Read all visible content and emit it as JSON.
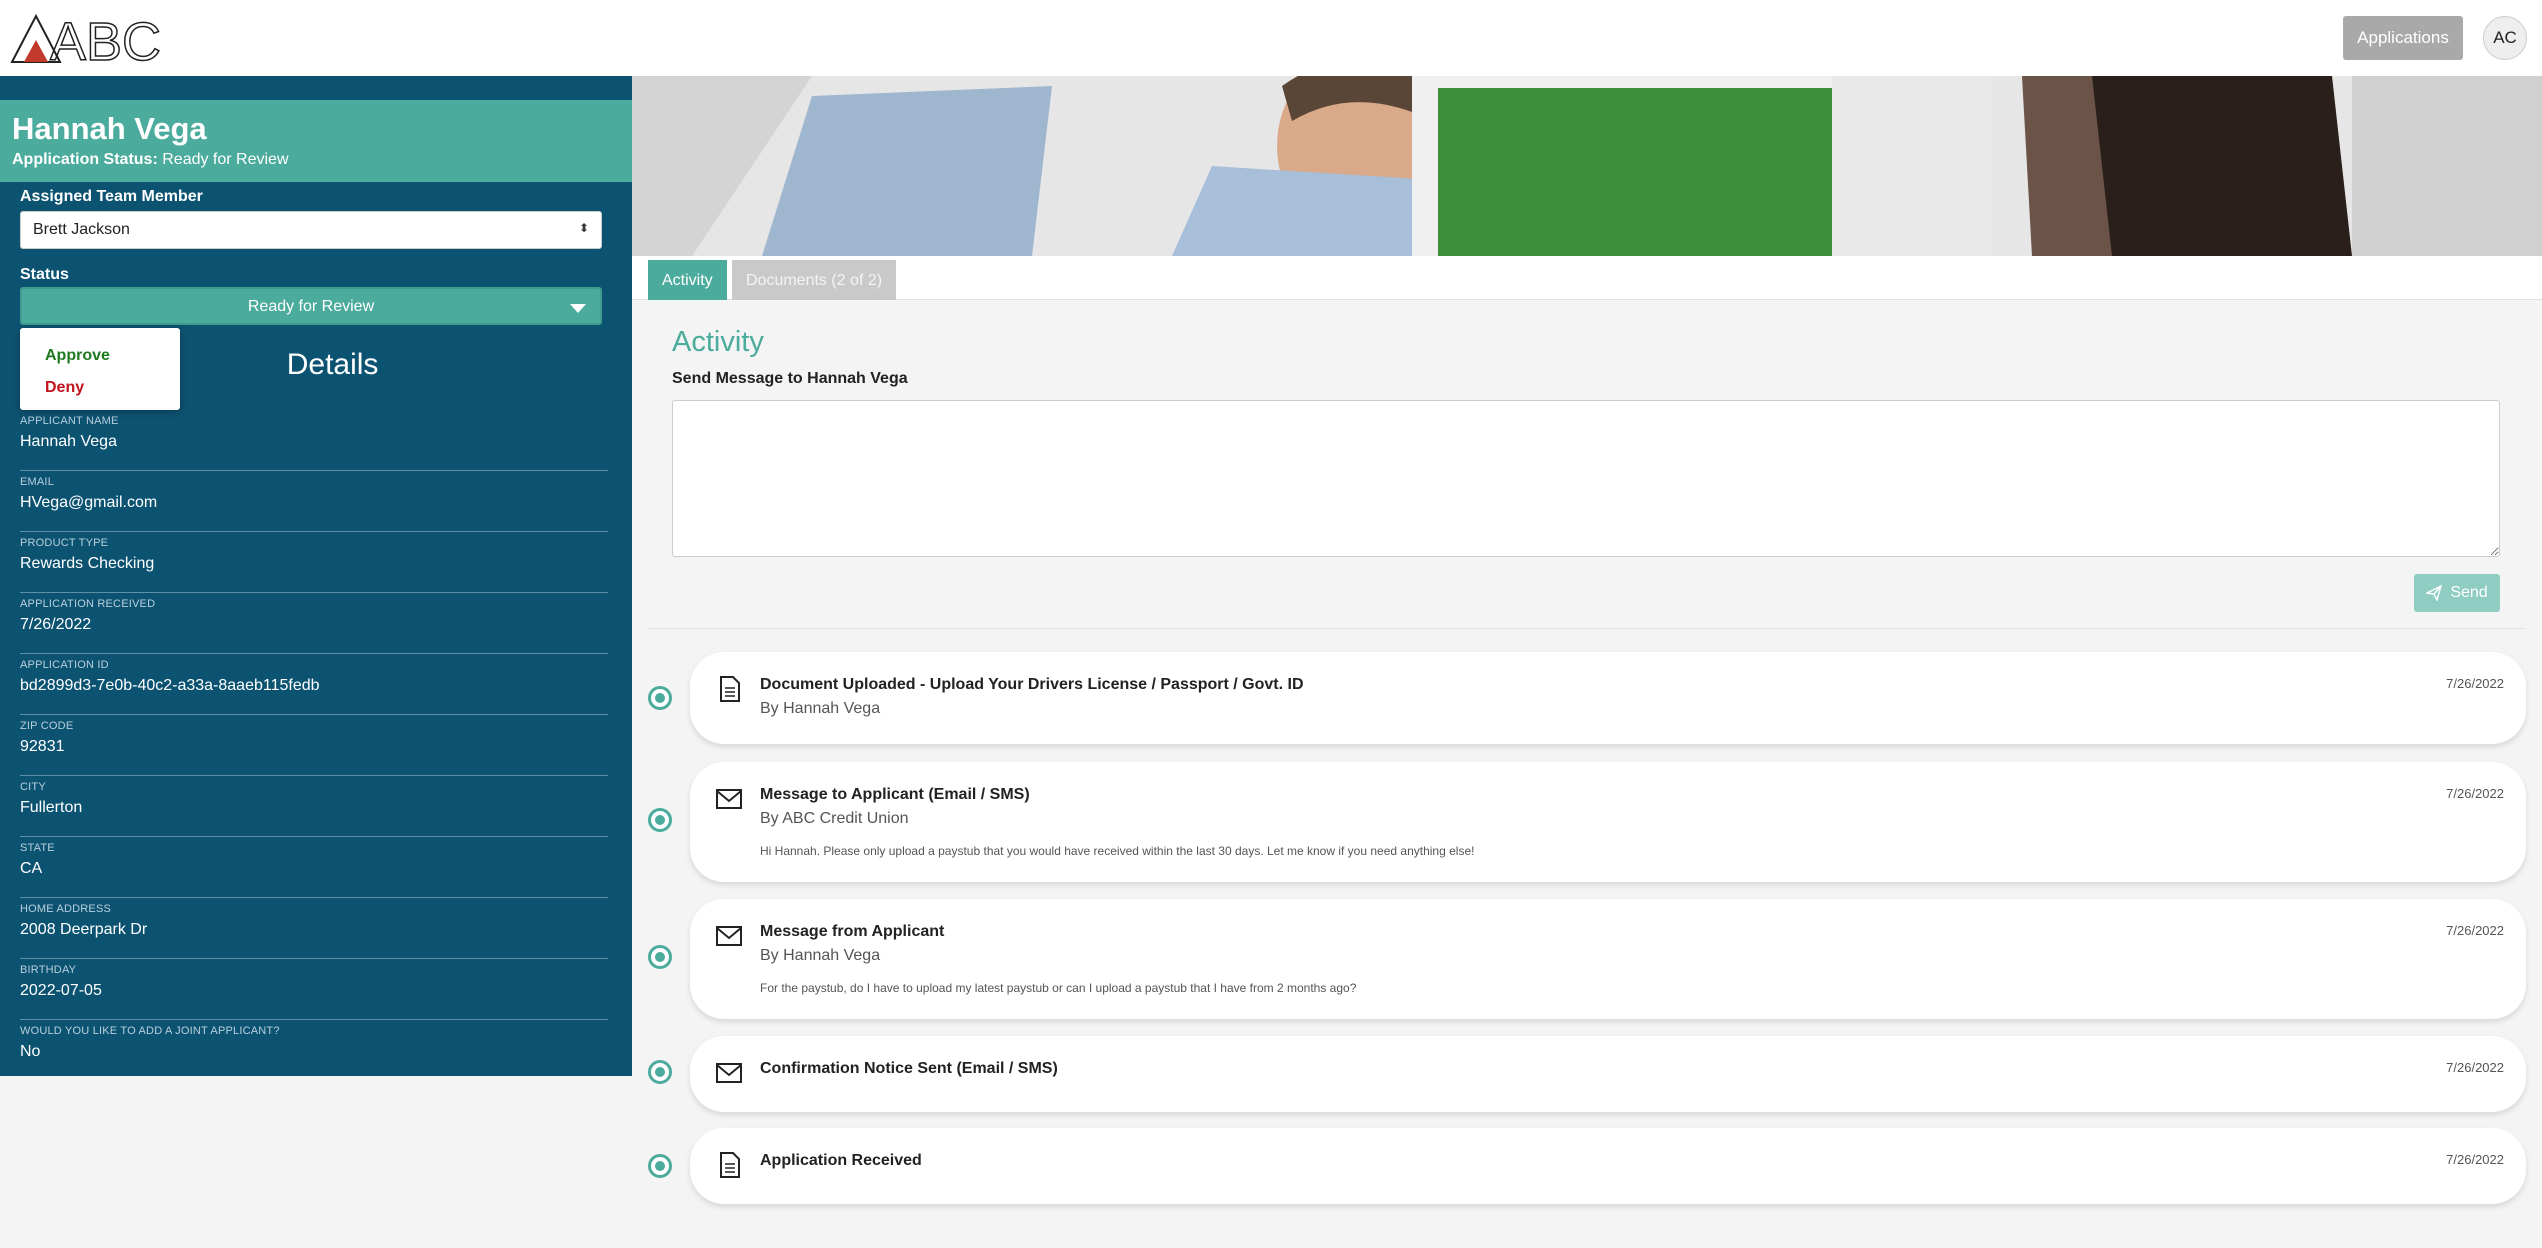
{
  "header": {
    "logo_text": "ABC",
    "applications_label": "Applications",
    "avatar_initials": "AC"
  },
  "applicant": {
    "name": "Hannah Vega",
    "status_label": "Application Status:",
    "status_value": "Ready for Review"
  },
  "assignment": {
    "team_label": "Assigned Team Member",
    "team_value": "Brett Jackson",
    "status_label": "Status",
    "status_value": "Ready for Review",
    "status_options": [
      "Approve",
      "Deny"
    ],
    "details_heading": "Details"
  },
  "fields": [
    {
      "key": "APPLICANT NAME",
      "value": "Hannah Vega"
    },
    {
      "key": "EMAIL",
      "value": "HVega@gmail.com"
    },
    {
      "key": "PRODUCT TYPE",
      "value": "Rewards Checking"
    },
    {
      "key": "APPLICATION RECEIVED",
      "value": "7/26/2022"
    },
    {
      "key": "APPLICATION ID",
      "value": "bd2899d3-7e0b-40c2-a33a-8aaeb115fedb"
    },
    {
      "key": "ZIP CODE",
      "value": "92831"
    },
    {
      "key": "CITY",
      "value": "Fullerton"
    },
    {
      "key": "STATE",
      "value": "CA"
    },
    {
      "key": "HOME ADDRESS",
      "value": "2008 Deerpark Dr"
    },
    {
      "key": "BIRTHDAY",
      "value": "2022-07-05"
    },
    {
      "key": "WOULD YOU LIKE TO ADD A JOINT APPLICANT?",
      "value": "No"
    }
  ],
  "tabs": {
    "activity": "Activity",
    "documents": "Documents (2 of 2)"
  },
  "activity": {
    "title": "Activity",
    "send_label": "Send Message to Hannah Vega",
    "message_placeholder": "",
    "send_button": "Send"
  },
  "timeline": [
    {
      "icon": "document-icon",
      "title": "Document Uploaded - Upload Your Drivers License / Passport / Govt. ID",
      "by": "By Hannah Vega",
      "body": "",
      "date": "7/26/2022"
    },
    {
      "icon": "envelope-icon",
      "title": "Message to Applicant (Email / SMS)",
      "by": "By ABC Credit Union",
      "body": "Hi Hannah. Please only upload a paystub that you would have received within the last 30 days. Let me know if you need anything else!",
      "date": "7/26/2022"
    },
    {
      "icon": "envelope-icon",
      "title": "Message from Applicant",
      "by": "By Hannah Vega",
      "body": "For the paystub, do I have to upload my latest paystub or can I upload a paystub that I have from 2 months ago?",
      "date": "7/26/2022"
    },
    {
      "icon": "envelope-icon",
      "title": "Confirmation Notice Sent (Email / SMS)",
      "by": "",
      "body": "",
      "date": "7/26/2022"
    },
    {
      "icon": "document-icon",
      "title": "Application Received",
      "by": "",
      "body": "",
      "date": "7/26/2022"
    }
  ],
  "colors": {
    "sidebar": "#0c5372",
    "accent": "#4bab9c",
    "approve": "#1f7a1f",
    "deny": "#c0151c"
  }
}
